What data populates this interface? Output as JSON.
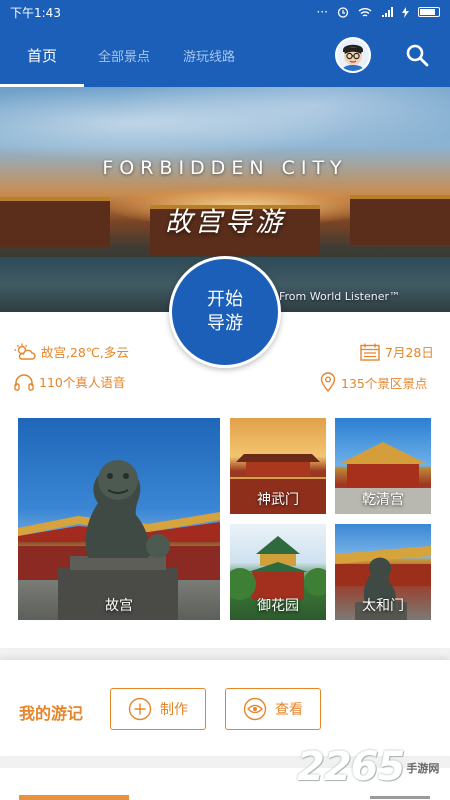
{
  "status_bar": {
    "time": "下午1:43"
  },
  "header": {
    "tabs": [
      {
        "label": "首页",
        "active": true
      },
      {
        "label": "全部景点",
        "active": false
      },
      {
        "label": "游玩线路",
        "active": false
      }
    ],
    "accent_color": "#1b5fb8"
  },
  "banner": {
    "title_en": "FORBIDDEN CITY",
    "title_zh": "故宫导游",
    "credit": "From World Listener™"
  },
  "start_button": {
    "line1": "开始",
    "line2": "导游"
  },
  "info": {
    "weather": "故宫,28℃,多云",
    "date": "7月28日",
    "voices": "110个真人语音",
    "spots": "135个景区景点"
  },
  "tiles": [
    {
      "label": "故宫"
    },
    {
      "label": "神武门"
    },
    {
      "label": "乾清宫"
    },
    {
      "label": "御花园"
    },
    {
      "label": "太和门"
    }
  ],
  "travel_notes": {
    "title": "我的游记",
    "make_label": "制作",
    "view_label": "查看",
    "accent_color": "#e6852a"
  },
  "bottom": {
    "left": "",
    "right": ""
  },
  "watermark": {
    "text": "2265",
    "suffix": "手游网"
  }
}
